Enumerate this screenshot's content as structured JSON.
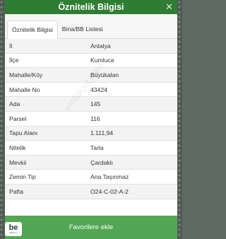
{
  "header": {
    "title": "Öznitelik Bilgisi",
    "close_icon": "close-icon"
  },
  "tabs": [
    {
      "label": "Öznitelik Bilgisi",
      "active": true
    },
    {
      "label": "Bina/BB Listesi",
      "active": false
    }
  ],
  "rows": [
    {
      "label": "İl",
      "value": "Antalya"
    },
    {
      "label": "İlçe",
      "value": "Kumluca"
    },
    {
      "label": "Mahalle/Köy",
      "value": "Büyükalan"
    },
    {
      "label": "Mahalle No",
      "value": "43424"
    },
    {
      "label": "Ada",
      "value": "145"
    },
    {
      "label": "Parsel",
      "value": "116"
    },
    {
      "label": "Tapu Alanı",
      "value": "1.111,94"
    },
    {
      "label": "Nitelik",
      "value": "Tarla"
    },
    {
      "label": "Mevkii",
      "value": "Çardaklı"
    },
    {
      "label": "Zemin Tip",
      "value": "Ana Taşınmaz"
    },
    {
      "label": "Pafta",
      "value": "O24-C-02-A-2"
    }
  ],
  "watermark": "emlakjet.com",
  "footer": {
    "button_label": "Favorilere ekle"
  },
  "logo": {
    "mark": "be",
    "sub": "REALTY"
  },
  "colors": {
    "header": "#2e7d32",
    "footer": "#53a653"
  }
}
